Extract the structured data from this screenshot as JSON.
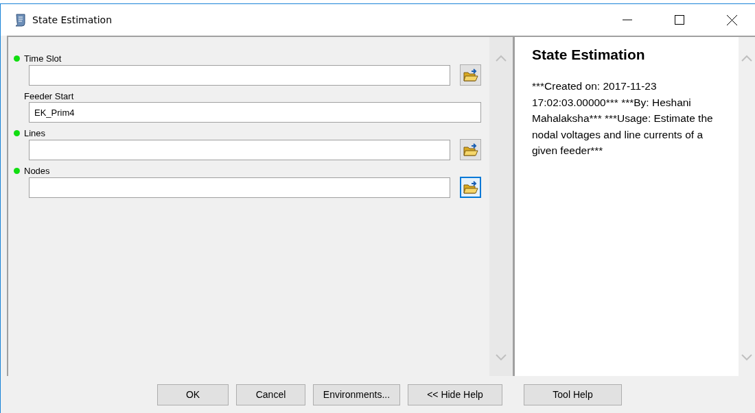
{
  "window": {
    "title": "State Estimation"
  },
  "parameters": [
    {
      "label": "Time Slot",
      "required": true,
      "browse": true,
      "focused": false
    },
    {
      "label": "Feeder Start",
      "required": false,
      "value": "EK_Prim4",
      "browse": false
    },
    {
      "label": "Lines",
      "required": true,
      "browse": true,
      "focused": false
    },
    {
      "label": "Nodes",
      "required": true,
      "browse": true,
      "focused": true
    }
  ],
  "help": {
    "title": "State Estimation",
    "text": "***Created on: 2017-11-23 17:02:03.00000*** ***By: Heshani Mahalaksha*** ***Usage: Estimate the nodal voltages and line currents of a given feeder***"
  },
  "buttons": [
    "OK",
    "Cancel",
    "Environments...",
    "<< Hide Help",
    "Tool Help"
  ]
}
